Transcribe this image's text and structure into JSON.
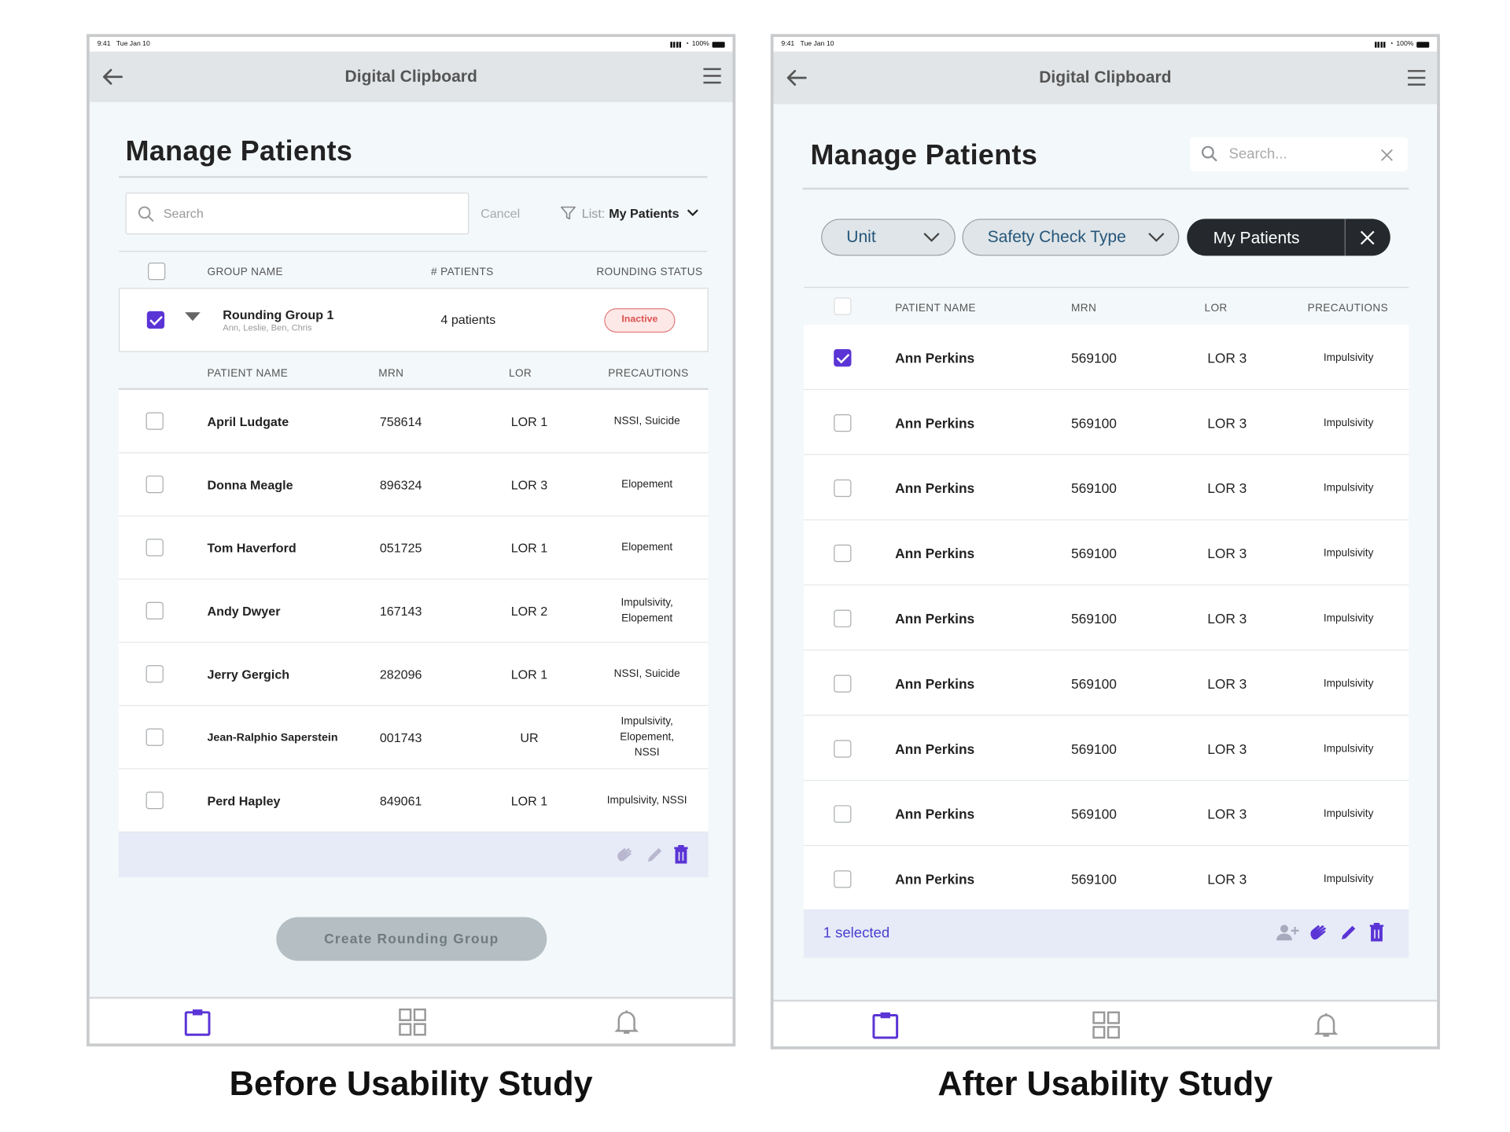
{
  "before": {
    "caption": "Before Usability Study",
    "status": {
      "time": "9:41",
      "date": "Tue Jan 10",
      "battery": "100%"
    },
    "app_title": "Digital Clipboard",
    "page_title": "Manage Patients",
    "search_placeholder": "Search",
    "cancel_label": "Cancel",
    "list_prefix": "List:",
    "list_value": "My Patients",
    "group_headers": [
      "GROUP NAME",
      "# PATIENTS",
      "ROUNDING STATUS"
    ],
    "group": {
      "name": "Rounding Group 1",
      "members": "Ann, Leslie, Ben, Chris",
      "count": "4 patients",
      "status": "Inactive"
    },
    "patient_headers": [
      "PATIENT NAME",
      "MRN",
      "LOR",
      "PRECAUTIONS"
    ],
    "patients": [
      {
        "name": "April Ludgate",
        "mrn": "758614",
        "lor": "LOR 1",
        "precautions": [
          "NSSI, Suicide"
        ]
      },
      {
        "name": "Donna Meagle",
        "mrn": "896324",
        "lor": "LOR 3",
        "precautions": [
          "Elopement"
        ]
      },
      {
        "name": "Tom Haverford",
        "mrn": "051725",
        "lor": "LOR 1",
        "precautions": [
          "Elopement"
        ]
      },
      {
        "name": "Andy Dwyer",
        "mrn": "167143",
        "lor": "LOR 2",
        "precautions": [
          "Impulsivity,",
          "Elopement"
        ]
      },
      {
        "name": "Jerry Gergich",
        "mrn": "282096",
        "lor": "LOR 1",
        "precautions": [
          "NSSI, Suicide"
        ]
      },
      {
        "name": "Jean-Ralphio Saperstein",
        "mrn": "001743",
        "lor": "UR",
        "precautions": [
          "Impulsivity,",
          "Elopement,",
          "NSSI"
        ]
      },
      {
        "name": "Perd Hapley",
        "mrn": "849061",
        "lor": "LOR 1",
        "precautions": [
          "Impulsivity, NSSI"
        ]
      }
    ],
    "create_button": "Create Rounding Group"
  },
  "after": {
    "caption": "After Usability Study",
    "status": {
      "time": "9:41",
      "date": "Tue Jan 10",
      "battery": "100%"
    },
    "app_title": "Digital Clipboard",
    "page_title": "Manage Patients",
    "search_placeholder": "Search...",
    "filters": {
      "unit": "Unit",
      "safety": "Safety Check Type",
      "my_patients": "My Patients"
    },
    "patient_headers": [
      "PATIENT NAME",
      "MRN",
      "LOR",
      "PRECAUTIONS"
    ],
    "patients": [
      {
        "name": "Ann Perkins",
        "mrn": "569100",
        "lor": "LOR 3",
        "precautions": "Impulsivity",
        "checked": true
      },
      {
        "name": "Ann Perkins",
        "mrn": "569100",
        "lor": "LOR 3",
        "precautions": "Impulsivity",
        "checked": false
      },
      {
        "name": "Ann Perkins",
        "mrn": "569100",
        "lor": "LOR 3",
        "precautions": "Impulsivity",
        "checked": false
      },
      {
        "name": "Ann Perkins",
        "mrn": "569100",
        "lor": "LOR 3",
        "precautions": "Impulsivity",
        "checked": false
      },
      {
        "name": "Ann Perkins",
        "mrn": "569100",
        "lor": "LOR 3",
        "precautions": "Impulsivity",
        "checked": false
      },
      {
        "name": "Ann Perkins",
        "mrn": "569100",
        "lor": "LOR 3",
        "precautions": "Impulsivity",
        "checked": false
      },
      {
        "name": "Ann Perkins",
        "mrn": "569100",
        "lor": "LOR 3",
        "precautions": "Impulsivity",
        "checked": false
      },
      {
        "name": "Ann Perkins",
        "mrn": "569100",
        "lor": "LOR 3",
        "precautions": "Impulsivity",
        "checked": false
      },
      {
        "name": "Ann Perkins",
        "mrn": "569100",
        "lor": "LOR 3",
        "precautions": "Impulsivity",
        "checked": false
      }
    ],
    "selected_label": "1 selected"
  },
  "colors": {
    "accent": "#5b34d6",
    "inactive": "#d9534f",
    "selected_text": "#4a3fd0",
    "toolbar_bg": "#e6ebf7"
  },
  "icons": [
    "back-arrow-icon",
    "hamburger-menu-icon",
    "search-icon",
    "filter-icon",
    "chevron-down-icon",
    "caret-down-icon",
    "close-icon",
    "hand-wave-icon",
    "pencil-icon",
    "trash-icon",
    "add-person-icon",
    "clipboard-icon",
    "grid-icon",
    "bell-icon"
  ]
}
